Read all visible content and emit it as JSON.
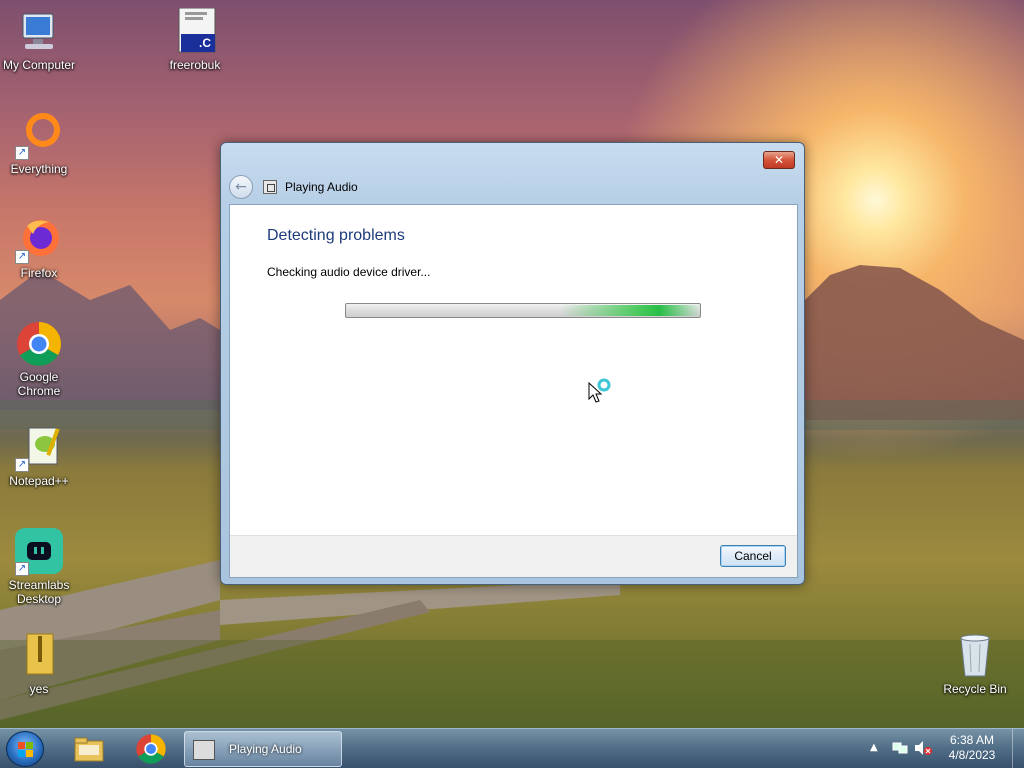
{
  "desktop": {
    "icons": [
      {
        "label": "My Computer"
      },
      {
        "label": "freerobuk"
      },
      {
        "label": "Everything"
      },
      {
        "label": "Firefox"
      },
      {
        "label": "Google Chrome"
      },
      {
        "label": "Notepad++"
      },
      {
        "label": "Streamlabs Desktop"
      },
      {
        "label": "yes"
      },
      {
        "label": "Recycle Bin"
      }
    ],
    "freerobuk_badge": ".C"
  },
  "dialog": {
    "title": "Playing Audio",
    "heading": "Detecting problems",
    "status": "Checking audio device driver...",
    "cancel_label": "Cancel",
    "close_glyph": "✕",
    "back_glyph": "←"
  },
  "taskbar": {
    "task_label": "Playing Audio",
    "time": "6:38 AM",
    "date": "4/8/2023"
  },
  "colors": {
    "heading": "#1e3c7a",
    "progress_glow": "#3cc850",
    "close_button": "#c03a22"
  }
}
